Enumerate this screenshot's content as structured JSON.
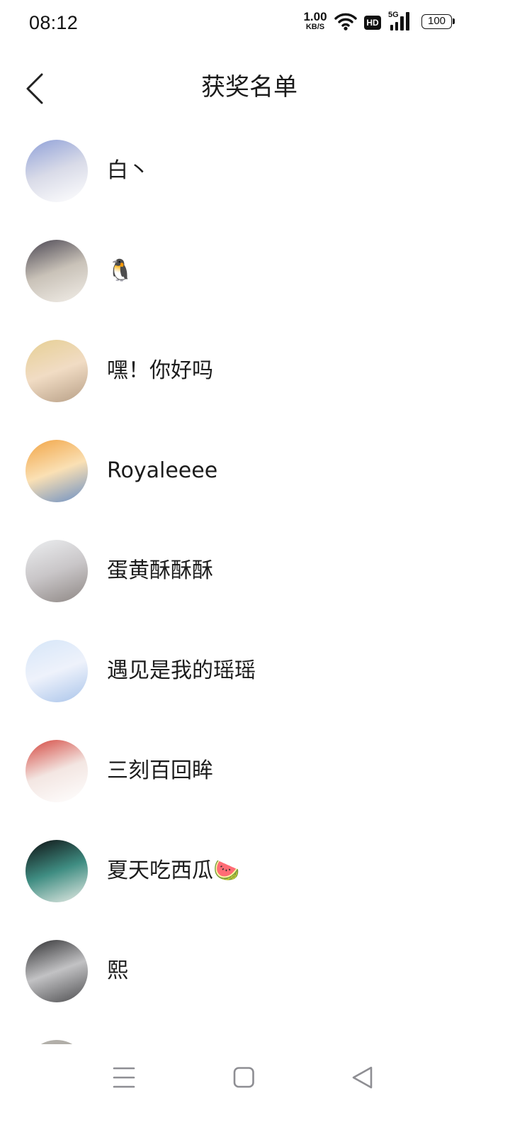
{
  "status_bar": {
    "time": "08:12",
    "net_speed": {
      "value": "1.00",
      "unit": "KB/S"
    },
    "hd_label": "HD",
    "network_type": "5G",
    "battery": "100",
    "icons": [
      "wifi-icon",
      "cellular-signal-icon",
      "battery-icon"
    ]
  },
  "header": {
    "back_icon": "back-chevron-icon",
    "title": "获奖名单"
  },
  "winners": [
    {
      "name": "白丶",
      "avatar_colors": [
        "#8fa0d8",
        "#d9dbe8",
        "#ffffff"
      ]
    },
    {
      "name": "🐧",
      "avatar_colors": [
        "#4a4652",
        "#c9c2b8",
        "#f2eee8"
      ]
    },
    {
      "name": "嘿！你好吗",
      "avatar_colors": [
        "#e6cf93",
        "#f1dcc4",
        "#b79f86"
      ]
    },
    {
      "name": "Royaleeee",
      "avatar_colors": [
        "#f2a445",
        "#fae0b4",
        "#6b8fc4"
      ]
    },
    {
      "name": "蛋黄酥酥酥",
      "avatar_colors": [
        "#eceef0",
        "#c9c6c8",
        "#8e8784"
      ]
    },
    {
      "name": "遇见是我的瑶瑶",
      "avatar_colors": [
        "#d6e6f8",
        "#eef2fb",
        "#a9c4ea"
      ]
    },
    {
      "name": "三刻百回眸",
      "avatar_colors": [
        "#d4463e",
        "#f3e6e2",
        "#ffffff"
      ]
    },
    {
      "name": "夏天吃西瓜🍉",
      "avatar_colors": [
        "#0e0f11",
        "#3f8d82",
        "#e8ece6"
      ]
    },
    {
      "name": "熙",
      "avatar_colors": [
        "#2f2f31",
        "#c2c2c4",
        "#4e4e50"
      ]
    },
    {
      "avatar_colors": [
        "#b6b3ad",
        "#9b9892"
      ]
    }
  ],
  "nav_bar": {
    "icons": [
      "menu-icon",
      "home-icon",
      "back-triangle-icon"
    ]
  },
  "colors": {
    "background": "#ffffff",
    "text": "#1c1c1c",
    "nav_icon": "#8e8e93"
  }
}
